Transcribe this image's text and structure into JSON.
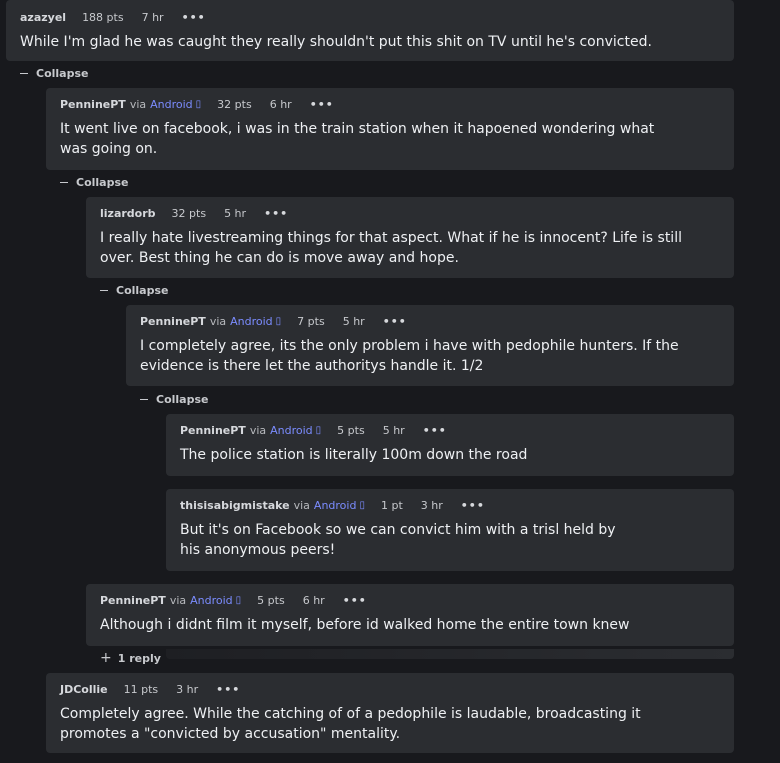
{
  "comments": [
    {
      "author": "azazyel",
      "via": "",
      "platform": "",
      "pts": "188 pts",
      "time": "7 hr",
      "more": "•••",
      "text": "While I'm glad he was caught they really shouldn't put this shit on TV until he's convicted."
    },
    {
      "author": "PenninePT",
      "via": "via",
      "platform": "Android",
      "pts": "32 pts",
      "time": "6 hr",
      "more": "•••",
      "text": "It went live on facebook, i was in the train station when it hapoened wondering what was going on."
    },
    {
      "author": "lizardorb",
      "via": "",
      "platform": "",
      "pts": "32 pts",
      "time": "5 hr",
      "more": "•••",
      "text": "I really hate livestreaming things for that aspect. What if he is innocent? Life is still over. Best thing he can do is move away and hope."
    },
    {
      "author": "PenninePT",
      "via": "via",
      "platform": "Android",
      "pts": "7 pts",
      "time": "5 hr",
      "more": "•••",
      "text": "I completely agree, its the only problem i have with pedophile hunters. If the evidence is there let the authoritys handle it. 1/2"
    },
    {
      "author": "PenninePT",
      "via": "via",
      "platform": "Android",
      "pts": "5 pts",
      "time": "5 hr",
      "more": "•••",
      "text": "The police station is literally 100m down the road"
    },
    {
      "author": "thisisabigmistake",
      "via": "via",
      "platform": "Android",
      "pts": "1 pt",
      "time": "3 hr",
      "more": "•••",
      "text": "But it's on Facebook so we can convict him with a trisl held by his anonymous peers!"
    },
    {
      "author": "PenninePT",
      "via": "via",
      "platform": "Android",
      "pts": "5 pts",
      "time": "6 hr",
      "more": "•••",
      "text": "Although i didnt film it myself, before id walked home the entire town knew"
    },
    {
      "author": "JDCollie",
      "via": "",
      "platform": "",
      "pts": "11 pts",
      "time": "3 hr",
      "more": "•••",
      "text": "Completely agree. While the catching of of a pedophile is laudable, broadcasting it promotes a \"convicted by accusation\" mentality."
    }
  ],
  "collapse_label": "Collapse",
  "reply_label": "1 reply",
  "icons": {
    "platform": "android-icon",
    "collapse": "minus-icon",
    "reply": "plus-icon",
    "more": "ellipsis-icon"
  },
  "colors": {
    "background": "#18191d",
    "card": "#2b2d31",
    "platform_link": "#7b8cff"
  }
}
